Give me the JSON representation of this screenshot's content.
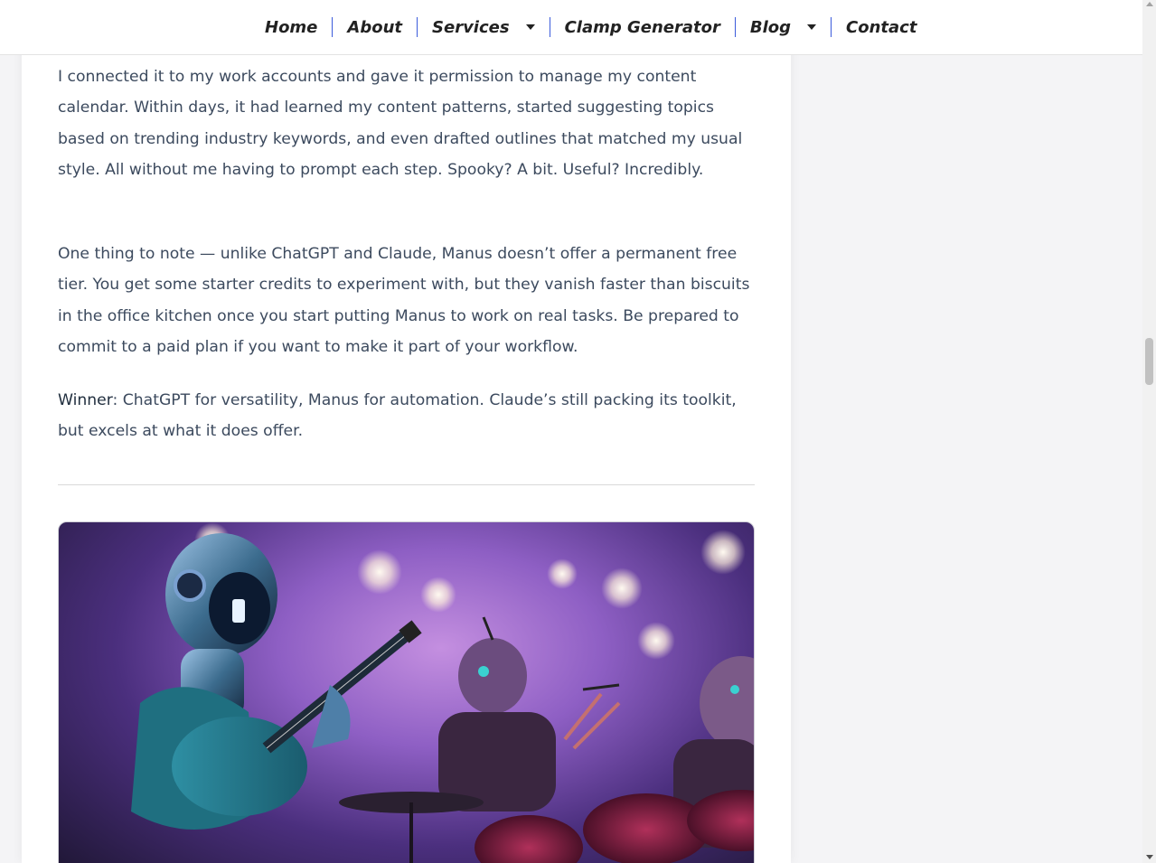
{
  "nav": {
    "items": [
      {
        "label": "Home",
        "has_dropdown": false
      },
      {
        "label": "About",
        "has_dropdown": false
      },
      {
        "label": "Services",
        "has_dropdown": true
      },
      {
        "label": "Clamp Generator",
        "has_dropdown": false
      },
      {
        "label": "Blog",
        "has_dropdown": true
      },
      {
        "label": "Contact",
        "has_dropdown": false
      }
    ]
  },
  "article": {
    "para1": "I connected it to my work accounts and gave it permission to manage my content calendar. Within days, it had learned my content patterns, started suggesting topics based on trending industry keywords, and even drafted outlines that matched my usual style. All without me having to prompt each step. Spooky? A bit. Useful? Incredibly.",
    "para2": "One thing to note — unlike ChatGPT and Claude, Manus doesn’t offer a permanent free tier. You get some starter credits to experiment with, but they vanish faster than biscuits in the office kitchen once you start putting Manus to work on real tasks. Be prepared to commit to a paid plan if you want to make it part of your workflow.",
    "winner_label": "Winner",
    "winner_text": ": ChatGPT for versatility, Manus for automation. Claude’s still packing its toolkit, but excels at what it does offer."
  },
  "colors": {
    "nav_separator": "#3b5bdb",
    "body_text": "#3c4a5e",
    "page_bg": "#f4f4f6"
  },
  "icons": {
    "dropdown": "caret-down-icon"
  }
}
